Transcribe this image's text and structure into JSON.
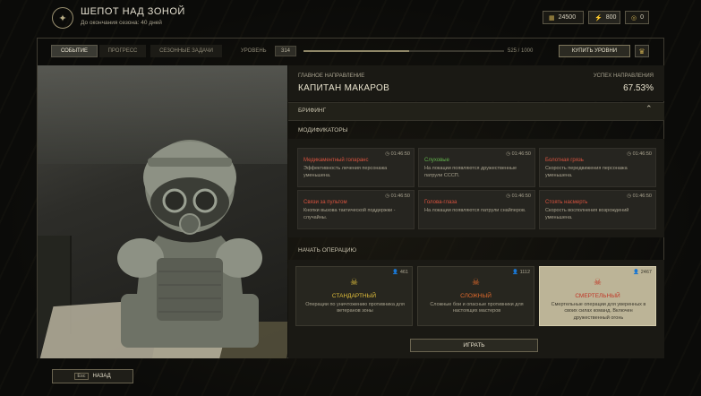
{
  "header": {
    "title": "ШЕПОТ НАД ЗОНОЙ",
    "subtitle": "До окончания сезона: 40 дней",
    "currencies": [
      {
        "icon": "coins-icon",
        "value": "24500"
      },
      {
        "icon": "bolt-icon",
        "value": "800"
      },
      {
        "icon": "token-icon",
        "value": "0"
      }
    ]
  },
  "nav": {
    "tabs": [
      "СОБЫТИЕ",
      "ПРОГРЕСС",
      "СЕЗОННЫЕ ЗАДАЧИ"
    ],
    "level_label": "УРОВЕНЬ",
    "level_value": "314",
    "progress_text": "525 / 1000",
    "progress_fraction": 0.525,
    "buy_label": "КУПИТЬ УРОВНИ"
  },
  "direction": {
    "label": "ГЛАВНОЕ НАПРАВЛЕНИЕ",
    "name": "КАПИТАН МАКАРОВ",
    "success_label": "УСПЕХ НАПРАВЛЕНИЯ",
    "success_value": "67.53%"
  },
  "briefing": {
    "label": "БРИФИНГ"
  },
  "modifiers": {
    "title": "МОДИФИКАТОРЫ",
    "items": [
      {
        "time": "01:46:50",
        "name": "Медикаментный голаранс",
        "color": "red",
        "desc": "Эффективность лечения персонажа уменьшена."
      },
      {
        "time": "01:46:50",
        "name": "Слуховые",
        "color": "green",
        "desc": "На локации появляются дружественные патрули СССП."
      },
      {
        "time": "01:46:50",
        "name": "Болотная грязь",
        "color": "red",
        "desc": "Скорость передвижения персонажа уменьшена."
      },
      {
        "time": "01:46:50",
        "name": "Связи за пультом",
        "color": "red",
        "desc": "Кнопки вызова тактической поддержки - случайны."
      },
      {
        "time": "01:46:50",
        "name": "Голова-глаза",
        "color": "red",
        "desc": "На локации появляются патрули снайперов."
      },
      {
        "time": "01:46:50",
        "name": "Стоять насмерть",
        "color": "red",
        "desc": "Скорость восполнения возрождений уменьшена."
      }
    ]
  },
  "operation": {
    "title": "НАЧАТЬ ОПЕРАЦИЮ",
    "modes": [
      {
        "count": "461",
        "icon": "skull-icon",
        "name": "СТАНДАРТНЫЙ",
        "color": "yellow",
        "desc": "Операции по уничтожению противника для ветеранов зоны"
      },
      {
        "count": "1112",
        "icon": "flame-skull-icon",
        "name": "СЛОЖНЫЙ",
        "color": "orange",
        "desc": "Сложные бои и опасные противники для настоящих мастеров"
      },
      {
        "count": "2467",
        "icon": "demon-skull-icon",
        "name": "СМЕРТЕЛЬНЫЙ",
        "color": "crimson",
        "desc": "Смертельные операции для уверенных в своих силах команд. Включен дружественный огонь"
      }
    ],
    "selected_index": 2,
    "play_label": "ИГРАТЬ"
  },
  "footer": {
    "back_key": "Esc",
    "back_label": "НАЗАД"
  }
}
